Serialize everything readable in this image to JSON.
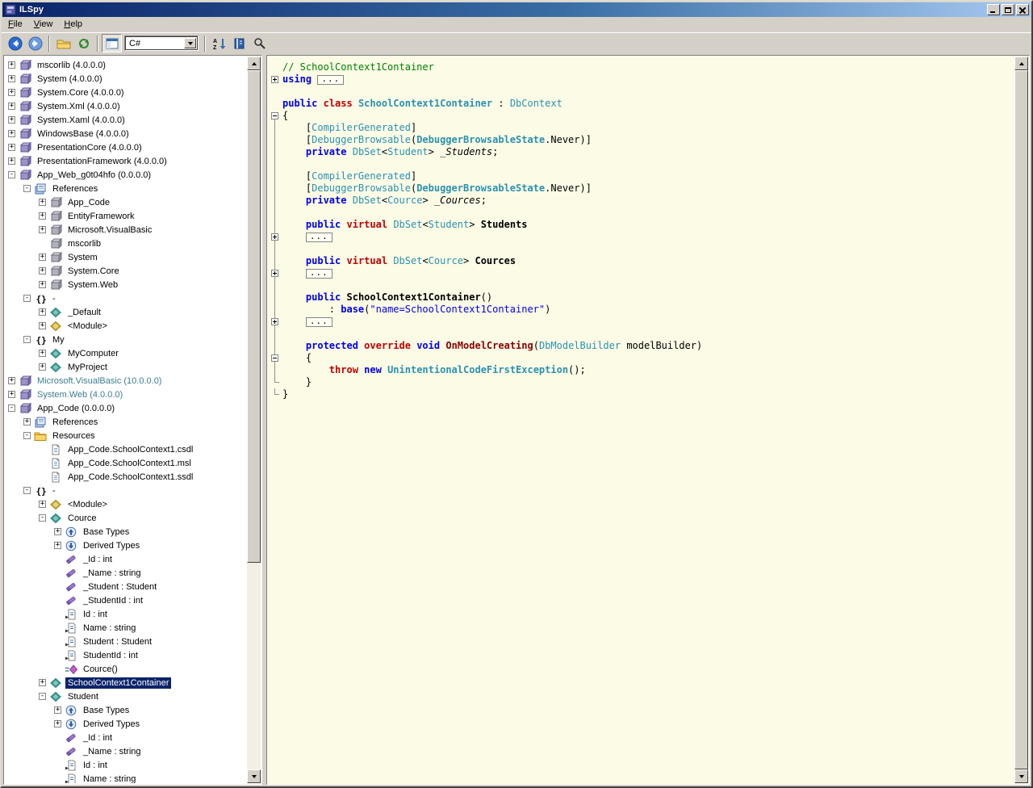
{
  "window": {
    "title": "ILSpy"
  },
  "menu": {
    "items": [
      "File",
      "View",
      "Help"
    ]
  },
  "toolbar": {
    "language": "C#",
    "items": [
      {
        "type": "button",
        "icon": "nav-back"
      },
      {
        "type": "button",
        "icon": "nav-forward"
      },
      {
        "type": "sep"
      },
      {
        "type": "button",
        "icon": "open-folder"
      },
      {
        "type": "button",
        "icon": "refresh"
      },
      {
        "type": "sep"
      },
      {
        "type": "button",
        "icon": "view-panel",
        "pressed": true
      },
      {
        "type": "combo"
      },
      {
        "type": "sep"
      },
      {
        "type": "button",
        "icon": "sort-az"
      },
      {
        "type": "button",
        "icon": "assembly-list"
      },
      {
        "type": "button",
        "icon": "search"
      }
    ]
  },
  "colors": {
    "selection": "#0A246A",
    "code_background": "#FBFBE6",
    "comment": "#008000",
    "keyword": "#0000E6",
    "type": "#2B91AF",
    "modifier": "#C00000",
    "string": "#0000E6",
    "method_name": "#8B0000",
    "muted_assembly": "#3E7D8E"
  },
  "tree": {
    "items": [
      {
        "lvl": 0,
        "exp": "+",
        "icon": "assembly",
        "label": "mscorlib (4.0.0.0)"
      },
      {
        "lvl": 0,
        "exp": "+",
        "icon": "assembly",
        "label": "System (4.0.0.0)"
      },
      {
        "lvl": 0,
        "exp": "+",
        "icon": "assembly",
        "label": "System.Core (4.0.0.0)"
      },
      {
        "lvl": 0,
        "exp": "+",
        "icon": "assembly",
        "label": "System.Xml (4.0.0.0)"
      },
      {
        "lvl": 0,
        "exp": "+",
        "icon": "assembly",
        "label": "System.Xaml (4.0.0.0)"
      },
      {
        "lvl": 0,
        "exp": "+",
        "icon": "assembly",
        "label": "WindowsBase (4.0.0.0)"
      },
      {
        "lvl": 0,
        "exp": "+",
        "icon": "assembly",
        "label": "PresentationCore (4.0.0.0)"
      },
      {
        "lvl": 0,
        "exp": "+",
        "icon": "assembly",
        "label": "PresentationFramework (4.0.0.0)"
      },
      {
        "lvl": 0,
        "exp": "-",
        "icon": "assembly",
        "label": "App_Web_g0t04hfo (0.0.0.0)"
      },
      {
        "lvl": 1,
        "exp": "-",
        "icon": "references",
        "label": "References"
      },
      {
        "lvl": 2,
        "exp": "+",
        "icon": "reference",
        "label": "App_Code"
      },
      {
        "lvl": 2,
        "exp": "+",
        "icon": "reference",
        "label": "EntityFramework"
      },
      {
        "lvl": 2,
        "exp": "+",
        "icon": "reference",
        "label": "Microsoft.VisualBasic"
      },
      {
        "lvl": 2,
        "exp": null,
        "icon": "reference",
        "label": "mscorlib"
      },
      {
        "lvl": 2,
        "exp": "+",
        "icon": "reference",
        "label": "System"
      },
      {
        "lvl": 2,
        "exp": "+",
        "icon": "reference",
        "label": "System.Core"
      },
      {
        "lvl": 2,
        "exp": "+",
        "icon": "reference",
        "label": "System.Web"
      },
      {
        "lvl": 1,
        "exp": "-",
        "icon": "namespace",
        "label": "-"
      },
      {
        "lvl": 2,
        "exp": "+",
        "icon": "class",
        "label": "_Default"
      },
      {
        "lvl": 2,
        "exp": "+",
        "icon": "module",
        "label": "<Module>"
      },
      {
        "lvl": 1,
        "exp": "-",
        "icon": "namespace",
        "label": "My"
      },
      {
        "lvl": 2,
        "exp": "+",
        "icon": "class",
        "label": "MyComputer"
      },
      {
        "lvl": 2,
        "exp": "+",
        "icon": "class",
        "label": "MyProject"
      },
      {
        "lvl": 0,
        "exp": "+",
        "icon": "assembly",
        "label": "Microsoft.VisualBasic (10.0.0.0)",
        "color": "muted"
      },
      {
        "lvl": 0,
        "exp": "+",
        "icon": "assembly",
        "label": "System.Web (4.0.0.0)",
        "color": "muted"
      },
      {
        "lvl": 0,
        "exp": "-",
        "icon": "assembly",
        "label": "App_Code (0.0.0.0)"
      },
      {
        "lvl": 1,
        "exp": "+",
        "icon": "references",
        "label": "References"
      },
      {
        "lvl": 1,
        "exp": "-",
        "icon": "folder",
        "label": "Resources"
      },
      {
        "lvl": 2,
        "exp": null,
        "icon": "file",
        "label": "App_Code.SchoolContext1.csdl"
      },
      {
        "lvl": 2,
        "exp": null,
        "icon": "file",
        "label": "App_Code.SchoolContext1.msl"
      },
      {
        "lvl": 2,
        "exp": null,
        "icon": "file",
        "label": "App_Code.SchoolContext1.ssdl"
      },
      {
        "lvl": 1,
        "exp": "-",
        "icon": "namespace",
        "label": "-"
      },
      {
        "lvl": 2,
        "exp": "+",
        "icon": "module",
        "label": "<Module>"
      },
      {
        "lvl": 2,
        "exp": "-",
        "icon": "class",
        "label": "Cource"
      },
      {
        "lvl": 3,
        "exp": "+",
        "icon": "basetypes",
        "label": "Base Types"
      },
      {
        "lvl": 3,
        "exp": "+",
        "icon": "derivedtypes",
        "label": "Derived Types"
      },
      {
        "lvl": 3,
        "exp": null,
        "icon": "field",
        "label": "_Id : int"
      },
      {
        "lvl": 3,
        "exp": null,
        "icon": "field",
        "label": "_Name : string"
      },
      {
        "lvl": 3,
        "exp": null,
        "icon": "field",
        "label": "_Student : Student"
      },
      {
        "lvl": 3,
        "exp": null,
        "icon": "field",
        "label": "_StudentId : int"
      },
      {
        "lvl": 3,
        "exp": null,
        "icon": "property",
        "label": "Id : int"
      },
      {
        "lvl": 3,
        "exp": null,
        "icon": "property",
        "label": "Name : string"
      },
      {
        "lvl": 3,
        "exp": null,
        "icon": "property",
        "label": "Student : Student"
      },
      {
        "lvl": 3,
        "exp": null,
        "icon": "property",
        "label": "StudentId : int"
      },
      {
        "lvl": 3,
        "exp": null,
        "icon": "method",
        "label": "Cource()"
      },
      {
        "lvl": 2,
        "exp": "+",
        "icon": "class",
        "label": "SchoolContext1Container",
        "selected": true
      },
      {
        "lvl": 2,
        "exp": "-",
        "icon": "class",
        "label": "Student"
      },
      {
        "lvl": 3,
        "exp": "+",
        "icon": "basetypes",
        "label": "Base Types"
      },
      {
        "lvl": 3,
        "exp": "+",
        "icon": "derivedtypes",
        "label": "Derived Types"
      },
      {
        "lvl": 3,
        "exp": null,
        "icon": "field",
        "label": "_Id : int"
      },
      {
        "lvl": 3,
        "exp": null,
        "icon": "field",
        "label": "_Name : string"
      },
      {
        "lvl": 3,
        "exp": null,
        "icon": "property",
        "label": "Id : int"
      },
      {
        "lvl": 3,
        "exp": null,
        "icon": "property",
        "label": "Name : string"
      }
    ]
  },
  "code": {
    "ellipsis": "...",
    "lines": [
      {
        "m": "none",
        "tk": [
          [
            "c",
            "// SchoolContext1Container"
          ]
        ]
      },
      {
        "m": "plus",
        "tk": [
          [
            "k",
            "using"
          ],
          [
            "p",
            " "
          ],
          [
            "box",
            ""
          ]
        ]
      },
      {
        "m": "none",
        "tk": []
      },
      {
        "m": "none",
        "tk": [
          [
            "k",
            "public"
          ],
          [
            "p",
            " "
          ],
          [
            "m",
            "class"
          ],
          [
            "p",
            " "
          ],
          [
            "tb",
            "SchoolContext1Container"
          ],
          [
            "p",
            " : "
          ],
          [
            "t",
            "DbContext"
          ]
        ]
      },
      {
        "m": "minus-top",
        "tk": [
          [
            "p",
            "{"
          ]
        ]
      },
      {
        "m": "line",
        "tk": [
          [
            "p",
            "    ["
          ],
          [
            "t",
            "CompilerGenerated"
          ],
          [
            "p",
            "]"
          ]
        ]
      },
      {
        "m": "line",
        "tk": [
          [
            "p",
            "    ["
          ],
          [
            "t",
            "DebuggerBrowsable"
          ],
          [
            "p",
            "("
          ],
          [
            "tb",
            "DebuggerBrowsableState"
          ],
          [
            "p",
            ".Never)]"
          ]
        ]
      },
      {
        "m": "line",
        "tk": [
          [
            "p",
            "    "
          ],
          [
            "k",
            "private"
          ],
          [
            "p",
            " "
          ],
          [
            "t",
            "DbSet"
          ],
          [
            "p",
            "<"
          ],
          [
            "t",
            "Student"
          ],
          [
            "p",
            "> "
          ],
          [
            "f",
            "_Students"
          ],
          [
            "p",
            ";"
          ]
        ]
      },
      {
        "m": "line",
        "tk": []
      },
      {
        "m": "line",
        "tk": [
          [
            "p",
            "    ["
          ],
          [
            "t",
            "CompilerGenerated"
          ],
          [
            "p",
            "]"
          ]
        ]
      },
      {
        "m": "line",
        "tk": [
          [
            "p",
            "    ["
          ],
          [
            "t",
            "DebuggerBrowsable"
          ],
          [
            "p",
            "("
          ],
          [
            "tb",
            "DebuggerBrowsableState"
          ],
          [
            "p",
            ".Never)]"
          ]
        ]
      },
      {
        "m": "line",
        "tk": [
          [
            "p",
            "    "
          ],
          [
            "k",
            "private"
          ],
          [
            "p",
            " "
          ],
          [
            "t",
            "DbSet"
          ],
          [
            "p",
            "<"
          ],
          [
            "t",
            "Cource"
          ],
          [
            "p",
            "> "
          ],
          [
            "f",
            "_Cources"
          ],
          [
            "p",
            ";"
          ]
        ]
      },
      {
        "m": "line",
        "tk": []
      },
      {
        "m": "line",
        "tk": [
          [
            "p",
            "    "
          ],
          [
            "k",
            "public"
          ],
          [
            "p",
            " "
          ],
          [
            "m",
            "virtual"
          ],
          [
            "p",
            " "
          ],
          [
            "t",
            "DbSet"
          ],
          [
            "p",
            "<"
          ],
          [
            "t",
            "Student"
          ],
          [
            "p",
            "> "
          ],
          [
            "n",
            "Students"
          ]
        ]
      },
      {
        "m": "plus-line",
        "tk": [
          [
            "p",
            "    "
          ],
          [
            "box",
            ""
          ]
        ]
      },
      {
        "m": "line",
        "tk": []
      },
      {
        "m": "line",
        "tk": [
          [
            "p",
            "    "
          ],
          [
            "k",
            "public"
          ],
          [
            "p",
            " "
          ],
          [
            "m",
            "virtual"
          ],
          [
            "p",
            " "
          ],
          [
            "t",
            "DbSet"
          ],
          [
            "p",
            "<"
          ],
          [
            "t",
            "Cource"
          ],
          [
            "p",
            "> "
          ],
          [
            "n",
            "Cources"
          ]
        ]
      },
      {
        "m": "plus-line",
        "tk": [
          [
            "p",
            "    "
          ],
          [
            "box",
            ""
          ]
        ]
      },
      {
        "m": "line",
        "tk": []
      },
      {
        "m": "line",
        "tk": [
          [
            "p",
            "    "
          ],
          [
            "k",
            "public"
          ],
          [
            "p",
            " "
          ],
          [
            "n",
            "SchoolContext1Container"
          ],
          [
            "p",
            "()"
          ]
        ]
      },
      {
        "m": "line",
        "tk": [
          [
            "p",
            "        : "
          ],
          [
            "k",
            "base"
          ],
          [
            "p",
            "("
          ],
          [
            "s",
            "\"name=SchoolContext1Container\""
          ],
          [
            "p",
            ")"
          ]
        ]
      },
      {
        "m": "plus-line",
        "tk": [
          [
            "p",
            "    "
          ],
          [
            "box",
            ""
          ]
        ]
      },
      {
        "m": "line",
        "tk": []
      },
      {
        "m": "line",
        "tk": [
          [
            "p",
            "    "
          ],
          [
            "k",
            "protected"
          ],
          [
            "p",
            " "
          ],
          [
            "m",
            "override"
          ],
          [
            "p",
            " "
          ],
          [
            "k",
            "void"
          ],
          [
            "p",
            " "
          ],
          [
            "mn",
            "OnModelCreating"
          ],
          [
            "p",
            "("
          ],
          [
            "t",
            "DbModelBuilder"
          ],
          [
            "p",
            " modelBuilder)"
          ]
        ]
      },
      {
        "m": "minus-mid",
        "tk": [
          [
            "p",
            "    {"
          ]
        ]
      },
      {
        "m": "line",
        "tk": [
          [
            "p",
            "        "
          ],
          [
            "m",
            "throw"
          ],
          [
            "p",
            " "
          ],
          [
            "k",
            "new"
          ],
          [
            "p",
            " "
          ],
          [
            "tb",
            "UnintentionalCodeFirstException"
          ],
          [
            "p",
            "();"
          ]
        ]
      },
      {
        "m": "end",
        "tk": [
          [
            "p",
            "    }"
          ]
        ]
      },
      {
        "m": "end",
        "tk": [
          [
            "p",
            "}"
          ]
        ]
      }
    ]
  }
}
